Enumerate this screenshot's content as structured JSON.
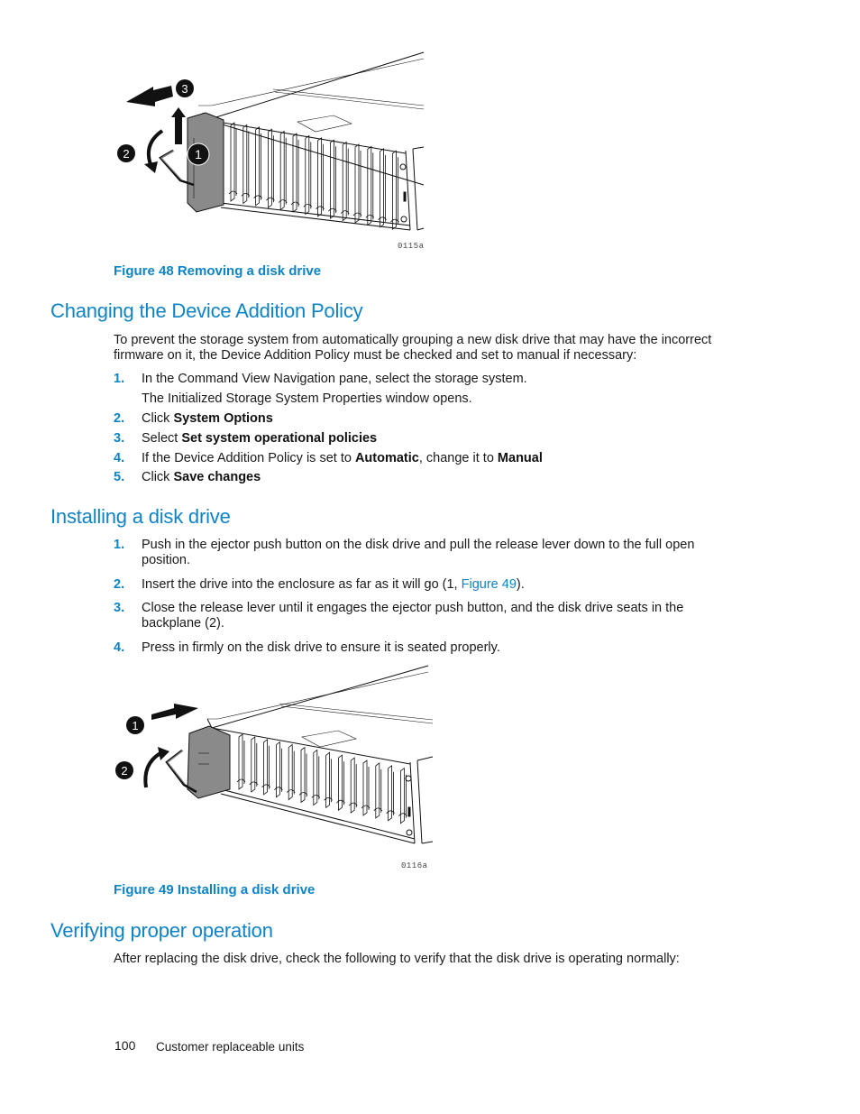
{
  "figure48": {
    "code": "0115a",
    "caption": "Figure 48 Removing a disk drive",
    "callouts": [
      "1",
      "2",
      "3"
    ]
  },
  "section1": {
    "title": "Changing the Device Addition Policy",
    "intro": "To prevent the storage system from automatically grouping a new disk drive that may have the incorrect firmware on it, the Device Addition Policy must be checked and set to manual if necessary:",
    "steps": [
      {
        "num": "1.",
        "text": "In the Command View Navigation pane, select the storage system.",
        "note": "The Initialized Storage System Properties window opens."
      },
      {
        "num": "2.",
        "pre": "Click ",
        "bold": "System Options"
      },
      {
        "num": "3.",
        "pre": "Select ",
        "bold": "Set system operational policies"
      },
      {
        "num": "4.",
        "pre": "If the Device Addition Policy is set to ",
        "bold": "Automatic",
        "mid": ", change it to ",
        "bold2": "Manual"
      },
      {
        "num": "5.",
        "pre": "Click ",
        "bold": "Save changes"
      }
    ]
  },
  "section2": {
    "title": "Installing a disk drive",
    "steps": [
      {
        "num": "1.",
        "line1": "Push in the ejector push button on the disk drive and pull the release lever down to the full open",
        "line2": "position."
      },
      {
        "num": "2.",
        "pre": "Insert the drive into the enclosure as far as it will go (1, ",
        "link": "Figure 49",
        "post": ")."
      },
      {
        "num": "3.",
        "line1": "Close the release lever until it engages the ejector push button, and the disk drive seats in the",
        "line2": "backplane (2)."
      },
      {
        "num": "4.",
        "text": "Press in firmly on the disk drive to ensure it is seated properly."
      }
    ]
  },
  "figure49": {
    "code": "0116a",
    "caption": "Figure 49 Installing a disk drive",
    "callouts": [
      "1",
      "2"
    ]
  },
  "section3": {
    "title": "Verifying proper operation",
    "intro": "After replacing the disk drive, check the following to verify that the disk drive is operating normally:"
  },
  "footer": {
    "page_number": "100",
    "chapter": "Customer replaceable units"
  },
  "colors": {
    "accent": "#0e84c6",
    "text": "#1a1a1a",
    "drive_gray": "#8a8a8a"
  }
}
